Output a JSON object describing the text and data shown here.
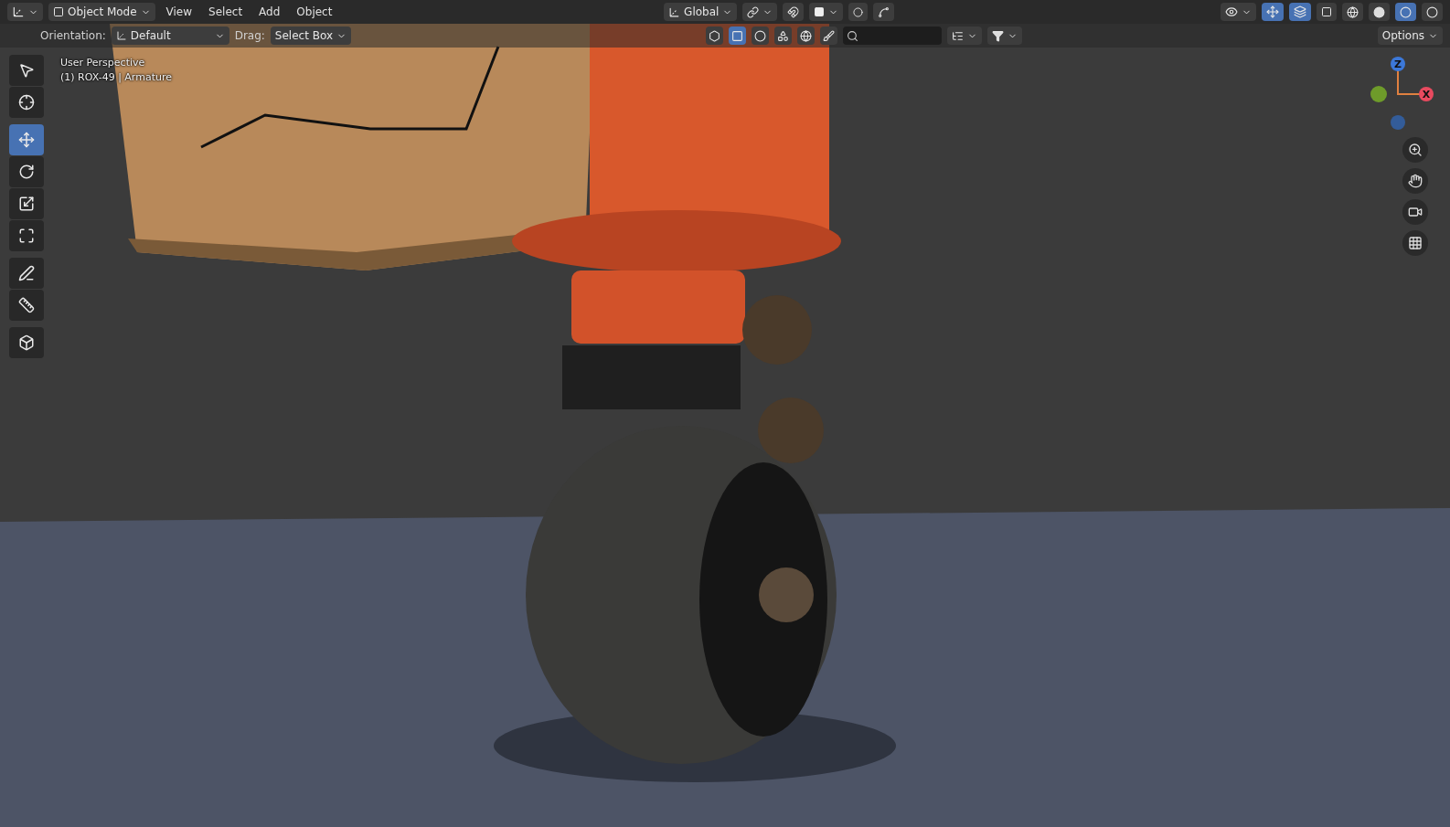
{
  "header": {
    "mode": "Object Mode",
    "menus": [
      "View",
      "Select",
      "Add",
      "Object"
    ],
    "orientation": "Global",
    "snap_on": false,
    "proportional_on": false,
    "visibility_on": false,
    "gizmos_on": true,
    "overlays_on": true,
    "xray_on": false,
    "shading": [
      {
        "kind": "wireframe",
        "selected": false
      },
      {
        "kind": "solid",
        "selected": false
      },
      {
        "kind": "material",
        "selected": true
      },
      {
        "kind": "rendered",
        "selected": false
      }
    ]
  },
  "tool_settings": {
    "orientation_label": "Orientation:",
    "orientation": "Default",
    "drag_label": "Drag:",
    "drag": "Select Box",
    "filters": [
      {
        "kind": "hexagon",
        "selected": false
      },
      {
        "kind": "square",
        "selected": true
      },
      {
        "kind": "sphere",
        "selected": false
      },
      {
        "kind": "shapes",
        "selected": false
      },
      {
        "kind": "globe",
        "selected": false
      },
      {
        "kind": "brush",
        "selected": false
      }
    ],
    "options": "Options"
  },
  "toolbar": [
    {
      "kind": "select",
      "selected": false
    },
    {
      "kind": "cursor",
      "selected": false
    },
    {
      "kind": "move",
      "selected": true
    },
    {
      "kind": "rotate",
      "selected": false
    },
    {
      "kind": "scale",
      "selected": false
    },
    {
      "kind": "transform",
      "selected": false
    },
    {
      "kind": "annotate",
      "selected": false
    },
    {
      "kind": "measure",
      "selected": false
    },
    {
      "kind": "add-cube",
      "selected": false
    }
  ],
  "viewport_info": [
    "User Perspective",
    "(1) ROX-49 | Armature"
  ],
  "gizmo": {
    "z_label": "Z",
    "x_label": "X"
  },
  "navigation": [
    {
      "kind": "zoom"
    },
    {
      "kind": "pan"
    },
    {
      "kind": "camera"
    },
    {
      "kind": "grid"
    }
  ]
}
